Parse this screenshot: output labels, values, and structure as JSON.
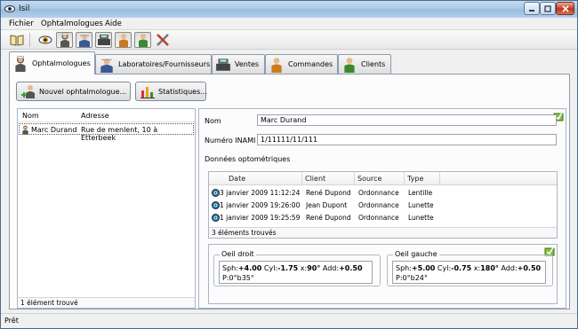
{
  "window": {
    "title": "Isil"
  },
  "menu": [
    "Fichier",
    "Ophtalmologues",
    "Aide"
  ],
  "toolbar": {
    "buttons": [
      "book-icon",
      "eye-icon",
      "ophthalmologist-icon",
      "supplier-icon",
      "cash-register-icon",
      "orders-icon",
      "client-icon",
      "tools-icon"
    ]
  },
  "tabs": [
    {
      "label": "Ophtalmologues",
      "icon": "ophthalmologist-icon"
    },
    {
      "label": "Laboratoires/Fournisseurs",
      "icon": "supplier-icon"
    },
    {
      "label": "Ventes",
      "icon": "cash-register-icon"
    },
    {
      "label": "Commandes",
      "icon": "orders-icon"
    },
    {
      "label": "Clients",
      "icon": "client-icon"
    }
  ],
  "actions": {
    "new_label": "Nouvel ophtalmologue...",
    "stats_label": "Statistiques..."
  },
  "list": {
    "columns": [
      "Nom",
      "Adresse"
    ],
    "rows": [
      {
        "name": "Marc Durand",
        "address": "Rue de menlent, 10 à Etterbeek"
      }
    ],
    "footer": "1 élément trouvé"
  },
  "detail": {
    "name_label": "Nom",
    "name_value": "Marc Durand",
    "inami_label": "Numéro INAMI",
    "inami_value": "1/11111/11/111",
    "optometric_title": "Données optométriques",
    "grid": {
      "columns": [
        "Date",
        "Client",
        "Source",
        "Type"
      ],
      "rows": [
        {
          "date": "3 janvier 2009 11:12:24",
          "client": "René Dupond",
          "source": "Ordonnance",
          "type": "Lentille"
        },
        {
          "date": "1 janvier 2009 19:26:00",
          "client": "Jean Dupont",
          "source": "Ordonnance",
          "type": "Lunette"
        },
        {
          "date": "1 janvier 2009 19:25:59",
          "client": "René Dupond",
          "source": "Ordonnance",
          "type": "Lunette"
        }
      ],
      "footer": "3 éléments trouvés"
    },
    "right_eye": {
      "title": "Oeil droit",
      "sph_label": "Sph:",
      "sph": "+4.00",
      "cyl_label": " Cyl:",
      "cyl": "-1.75",
      "x_label": " x:",
      "x": "90°",
      "add_label": " Add:",
      "add": "+0.50",
      "p_line": "P:0°b35°"
    },
    "left_eye": {
      "title": "Oeil gauche",
      "sph_label": "Sph:",
      "sph": "+5.00",
      "cyl_label": " Cyl:",
      "cyl": "-0.75",
      "x_label": " x:",
      "x": "180°",
      "add_label": " Add:",
      "add": "+0.50",
      "p_line": "P:0°b24°"
    }
  },
  "status": "Prêt"
}
